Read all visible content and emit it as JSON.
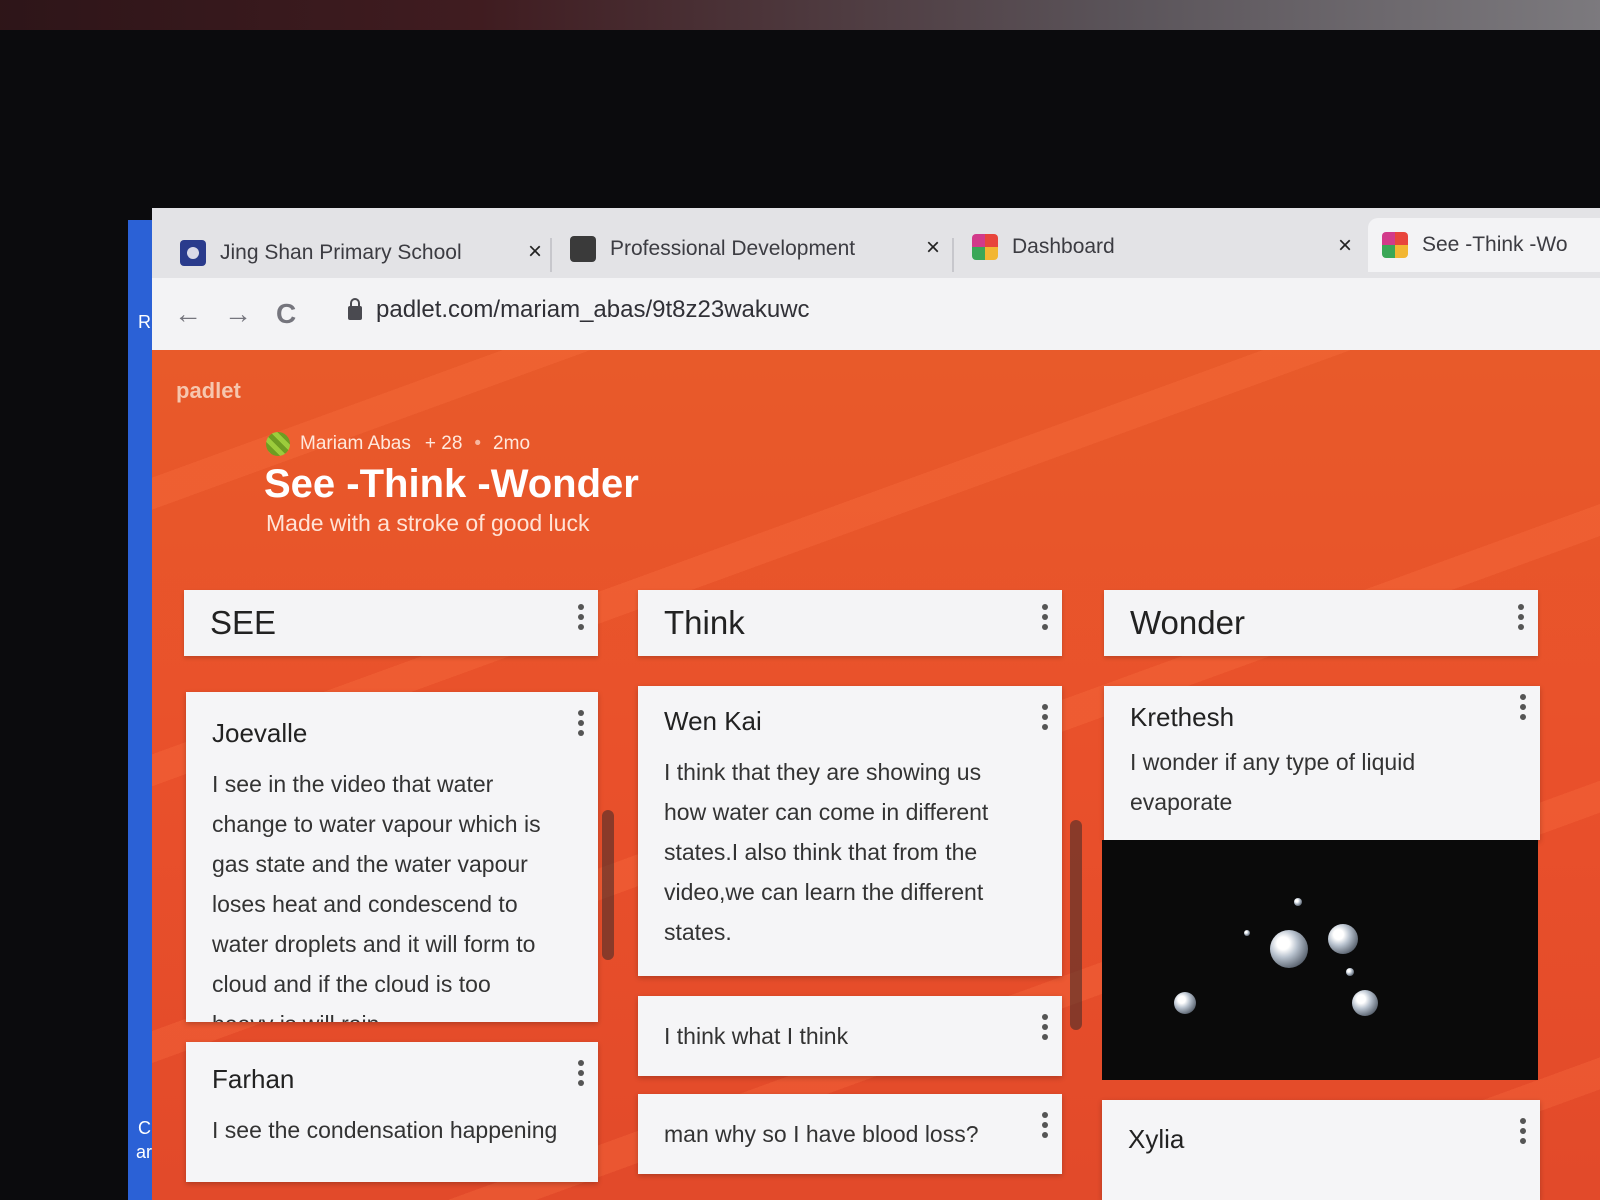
{
  "browser": {
    "tabs": [
      {
        "title": "Jing Shan Primary School",
        "icon": "school-crest-icon",
        "close": "×"
      },
      {
        "title": "Professional Development",
        "icon": "pd-logo-icon",
        "close": "×"
      },
      {
        "title": "Dashboard",
        "icon": "padlet-logo-icon",
        "close": "×"
      },
      {
        "title": "See -Think -Wo",
        "icon": "padlet-logo-icon"
      }
    ],
    "nav": {
      "back": "←",
      "forward": "→",
      "reload": "C"
    },
    "url": "padlet.com/mariam_abas/9t8z23wakuwc"
  },
  "side_fragments": {
    "top": "R",
    "bottom_1": "C",
    "bottom_2": "ar"
  },
  "padlet": {
    "logo": "padlet",
    "author": "Mariam Abas",
    "contributors": "+ 28",
    "separator": "•",
    "age": "2mo",
    "title": "See -Think -Wonder",
    "subtitle": "Made with a stroke of good luck",
    "background_color": "#e9502b"
  },
  "columns": [
    {
      "name": "SEE",
      "posts": [
        {
          "author": "Joevalle",
          "text": "I see in the video that water change to water vapour which is gas state and the water vapour loses heat and condescend to water droplets and it will form to cloud and if the cloud is too heavy is will rain"
        },
        {
          "author": "Farhan",
          "text": "I see the condensation happening"
        }
      ]
    },
    {
      "name": "Think",
      "posts": [
        {
          "author": "Wen Kai",
          "text": "I think that they are showing us how water can come in different states.I also think that from the video,we can learn the different states."
        },
        {
          "text": "I think what I think"
        },
        {
          "text": "man why so I have blood loss?"
        }
      ]
    },
    {
      "name": "Wonder",
      "posts": [
        {
          "author": "Krethesh",
          "text": "I wonder if any type of liquid evaporate",
          "image": "water-droplets-image"
        },
        {
          "author": "Xylia"
        }
      ]
    }
  ]
}
